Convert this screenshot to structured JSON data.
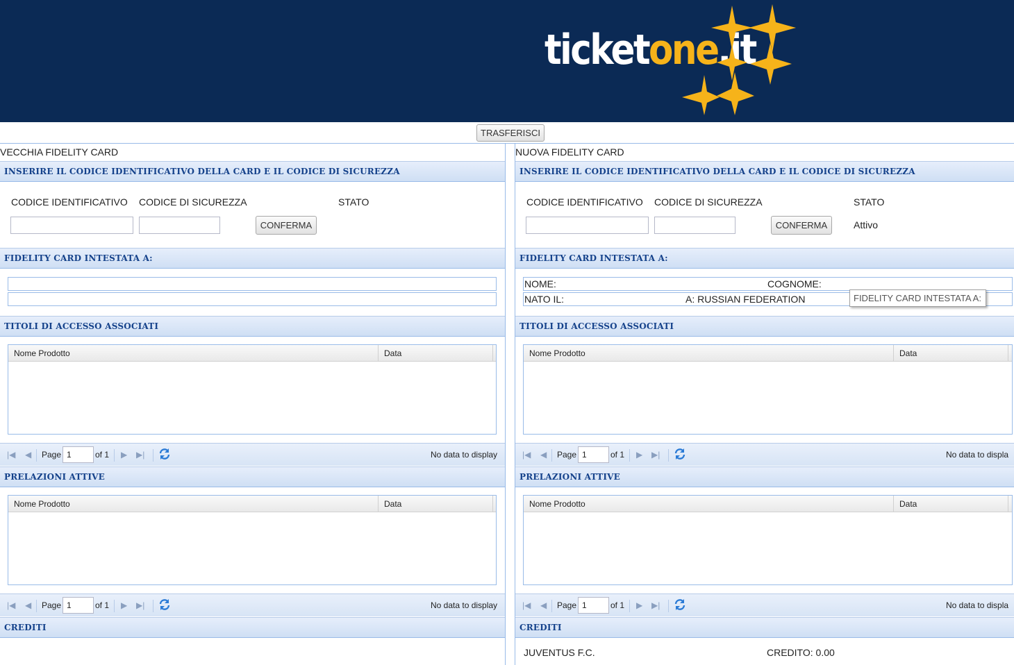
{
  "header": {
    "logo_white": "ticket",
    "logo_yellow": "one",
    "logo_tld": ".it"
  },
  "toolbar": {
    "transfer_label": "TRASFERISCI"
  },
  "colors": {
    "header_bg": "#0b2a55",
    "brand_yellow": "#f6b31a",
    "section_text": "#15428b"
  },
  "left": {
    "title": "VECCHIA FIDELITY CARD",
    "sec_code": "INSERIRE IL CODICE IDENTIFICATIVO DELLA CARD E IL CODICE DI SICUREZZA",
    "lbl_id": "CODICE IDENTIFICATIVO",
    "lbl_sec": "CODICE DI SICUREZZA",
    "lbl_stato": "STATO",
    "stato_value": "",
    "conferma": "CONFERMA",
    "sec_owner": "FIDELITY CARD INTESTATA A:",
    "sec_titoli": "TITOLI DI ACCESSO ASSOCIATI",
    "grid1": {
      "col1": "Nome Prodotto",
      "col2": "Data"
    },
    "pager1": {
      "page": "Page",
      "page_value": "1",
      "of": "of 1",
      "nodata": "No data to display"
    },
    "sec_prel": "PRELAZIONI ATTIVE",
    "grid2": {
      "col1": "Nome Prodotto",
      "col2": "Data"
    },
    "pager2": {
      "page": "Page",
      "page_value": "1",
      "of": "of 1",
      "nodata": "No data to display"
    },
    "sec_crediti": "CREDITI"
  },
  "right": {
    "title": "NUOVA FIDELITY CARD",
    "sec_code": "INSERIRE IL CODICE IDENTIFICATIVO DELLA CARD E IL CODICE DI SICUREZZA",
    "lbl_id": "CODICE IDENTIFICATIVO",
    "lbl_sec": "CODICE DI SICUREZZA",
    "lbl_stato": "STATO",
    "stato_value": "Attivo",
    "conferma": "CONFERMA",
    "sec_owner": "FIDELITY CARD INTESTATA A:",
    "owner": {
      "nome": "NOME:",
      "cognome": "COGNOME:",
      "nato": "NATO IL:",
      "luogo": "A: RUSSIAN FEDERATION"
    },
    "tooltip": "FIDELITY CARD INTESTATA A:",
    "sec_titoli": "TITOLI DI ACCESSO ASSOCIATI",
    "grid1": {
      "col1": "Nome Prodotto",
      "col2": "Data"
    },
    "pager1": {
      "page": "Page",
      "page_value": "1",
      "of": "of 1",
      "nodata": "No data to displa"
    },
    "sec_prel": "PRELAZIONI ATTIVE",
    "grid2": {
      "col1": "Nome Prodotto",
      "col2": "Data"
    },
    "pager2": {
      "page": "Page",
      "page_value": "1",
      "of": "of 1",
      "nodata": "No data to displa"
    },
    "sec_crediti": "CREDITI",
    "credit_club": "JUVENTUS F.C.",
    "credit_value": "CREDITO: 0.00"
  }
}
